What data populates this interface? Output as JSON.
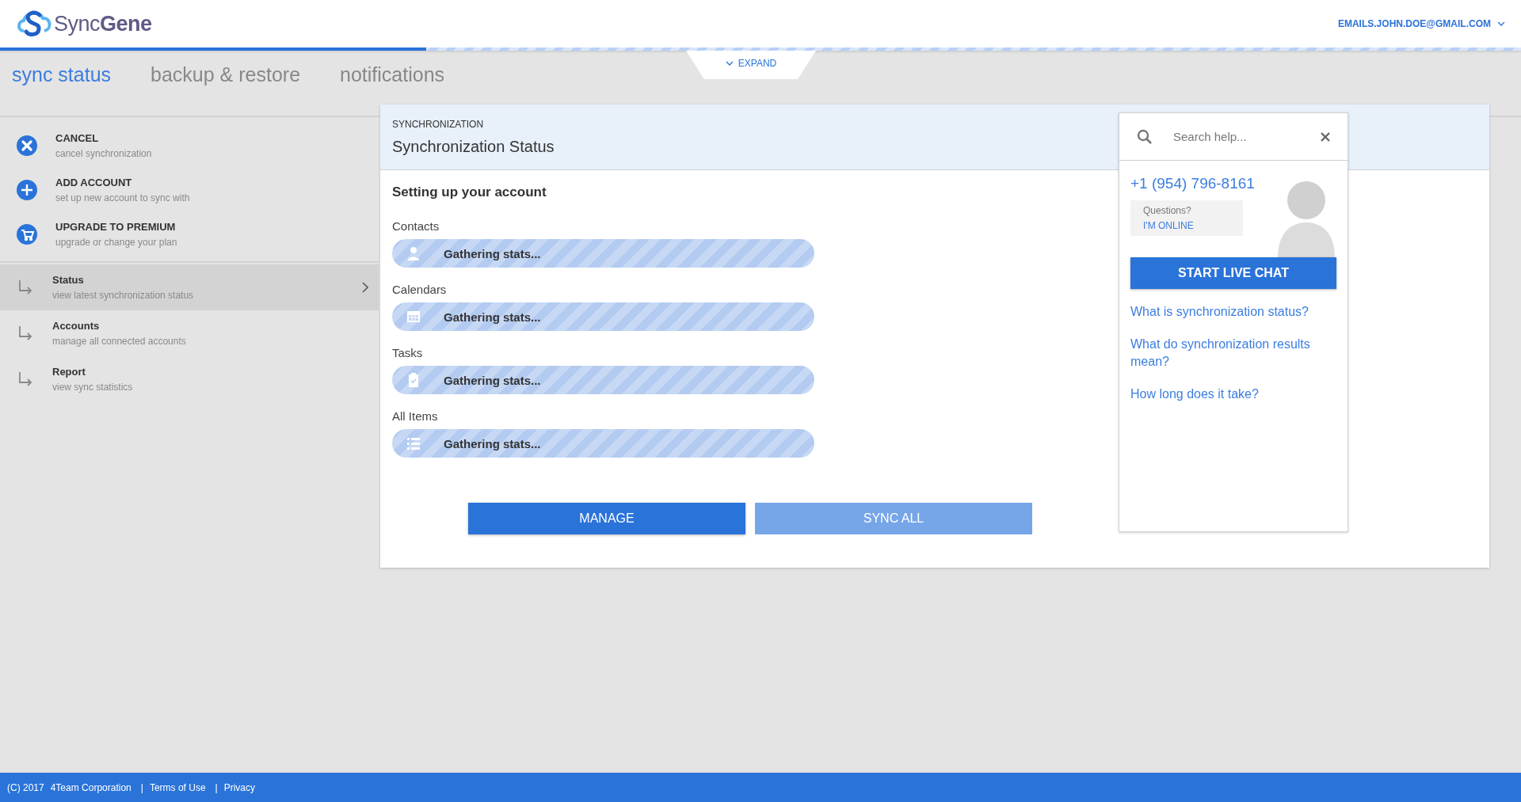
{
  "header": {
    "logo": "Sync**Gene**",
    "account": "EMAILS.JOHN.DOE@GMAIL.COM",
    "progress": {
      "level": 0.28
    }
  },
  "expand": "EXPAND",
  "tabs": [
    {
      "label": "sync status",
      "selected": true
    },
    {
      "label": "backup & restore",
      "selected": false
    },
    {
      "label": "notifications",
      "selected": false
    }
  ],
  "sidebar": {
    "actions": [
      {
        "kind": "cancel",
        "title": "CANCEL",
        "subtitle": "cancel synchronization"
      },
      {
        "kind": "add",
        "title": "ADD ACCOUNT",
        "subtitle": "set up new account to sync with"
      },
      {
        "kind": "upgrade",
        "title": "UPGRADE TO PREMIUM",
        "subtitle": "upgrade or change your plan"
      }
    ],
    "nav": [
      {
        "title": "Status",
        "subtitle": "view latest synchronization status",
        "selected": true
      },
      {
        "title": "Accounts",
        "subtitle": "manage all connected accounts",
        "selected": false
      },
      {
        "title": "Report",
        "subtitle": "view sync statistics",
        "selected": false
      }
    ]
  },
  "panel": {
    "overline": "SYNCHRONIZATION",
    "title": "Synchronization Status",
    "subtitle": "Setting up your account",
    "categories": [
      {
        "kind": "contacts",
        "label": "Contacts",
        "status": "Gathering stats..."
      },
      {
        "kind": "calendars",
        "label": "Calendars",
        "status": "Gathering stats..."
      },
      {
        "kind": "tasks",
        "label": "Tasks",
        "status": "Gathering stats..."
      },
      {
        "kind": "all",
        "label": "All Items",
        "status": "Gathering stats..."
      }
    ],
    "buttons": [
      {
        "label": "MANAGE",
        "disabled": false
      },
      {
        "label": "SYNC ALL",
        "disabled": true
      }
    ]
  },
  "help": {
    "placeholder": "Search help...",
    "phone": "+1 (954) 796-8161",
    "question": "Questions?",
    "status": "I'M ONLINE",
    "chat_button": "START LIVE CHAT",
    "links": [
      "What is synchronization status?",
      "What do synchronization results mean?",
      "How long does it take?"
    ]
  },
  "footer": [
    {
      "kind": "text",
      "text": "(C) 2017"
    },
    {
      "kind": "text",
      "text": "4Team Corporation"
    },
    {
      "kind": "sep",
      "text": "|"
    },
    {
      "kind": "link",
      "text": "Terms of Use"
    },
    {
      "kind": "sep",
      "text": "|"
    },
    {
      "kind": "link",
      "text": "Privacy"
    }
  ]
}
